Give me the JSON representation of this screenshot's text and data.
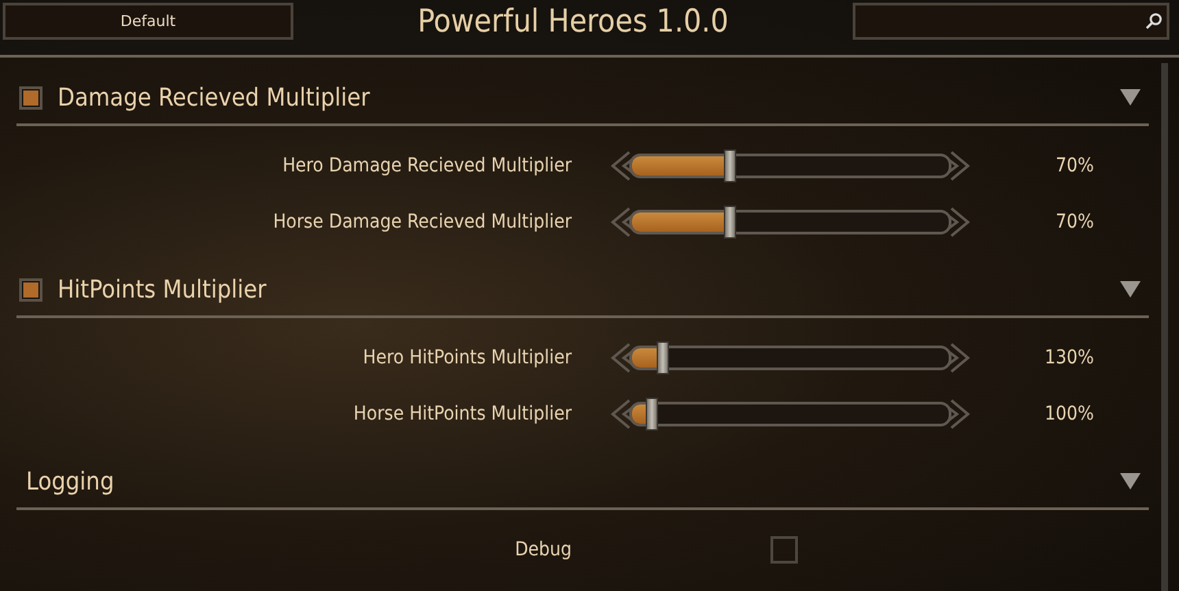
{
  "header": {
    "preset_button": "Default",
    "title": "Powerful Heroes 1.0.0"
  },
  "groups": [
    {
      "title": "Damage Recieved Multiplier",
      "kind": "toggle",
      "checked": true,
      "expanded": true,
      "settings": [
        {
          "kind": "slider",
          "label": "Hero Damage Recieved Multiplier",
          "level": 0.31,
          "reading": "70%"
        },
        {
          "kind": "slider",
          "label": "Horse Damage Recieved Multiplier",
          "level": 0.31,
          "reading": "70%"
        }
      ]
    },
    {
      "title": "HitPoints Multiplier",
      "kind": "toggle",
      "checked": true,
      "expanded": true,
      "settings": [
        {
          "kind": "slider",
          "label": "Hero HitPoints Multiplier",
          "level": 0.1,
          "reading": "130%"
        },
        {
          "kind": "slider",
          "label": "Horse HitPoints Multiplier",
          "level": 0.07,
          "reading": "100%"
        }
      ]
    },
    {
      "title": "Logging",
      "kind": "plain",
      "expanded": true,
      "settings": [
        {
          "kind": "checkbox",
          "label": "Debug",
          "checked": false
        }
      ]
    }
  ]
}
